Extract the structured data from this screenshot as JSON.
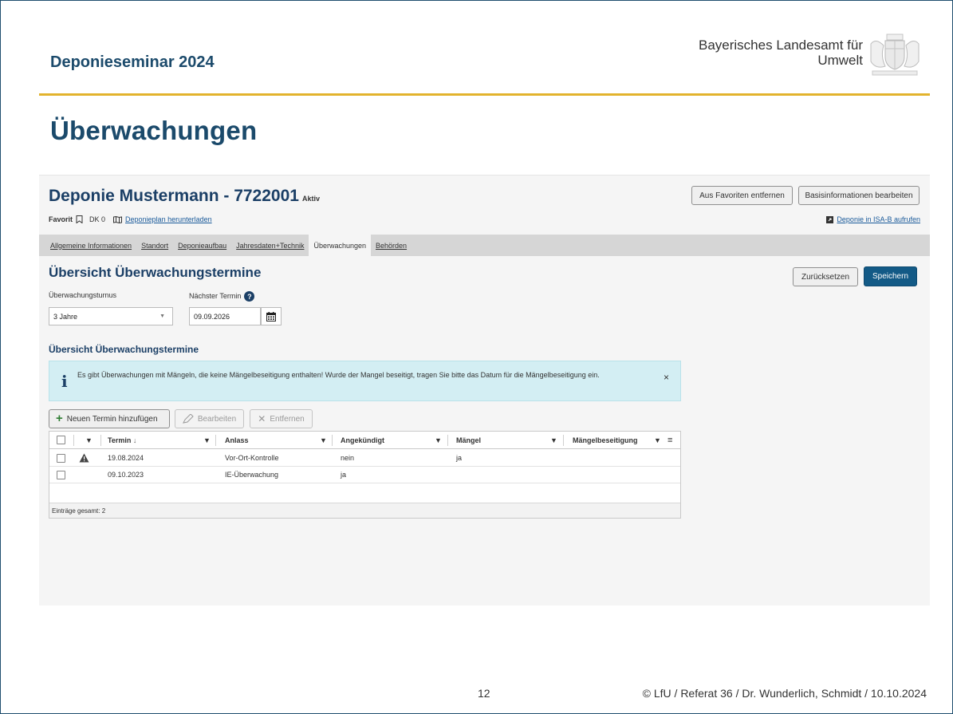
{
  "slide": {
    "seminar_title": "Deponieseminar 2024",
    "org_line1": "Bayerisches Landesamt für",
    "org_line2": "Umwelt",
    "heading": "Überwachungen",
    "page_number": "12",
    "footer": "© LfU / Referat 36 / Dr. Wunderlich, Schmidt / 10.10.2024",
    "accent_color": "#e2b32d",
    "title_color": "#1b4a6b"
  },
  "app": {
    "title": "Deponie Mustermann - 7722001",
    "status": "Aktiv",
    "buttons": {
      "remove_favorite": "Aus Favoriten entfernen",
      "edit_base": "Basisinformationen bearbeiten"
    },
    "meta": {
      "favorite_label": "Favorit",
      "favorite_icon": "bookmark-icon",
      "dk": "DK 0",
      "map_icon": "map-icon",
      "plan_link": "Deponieplan herunterladen",
      "isab_icon": "external-box-icon",
      "isab_link": "Deponie in ISA-B aufrufen"
    },
    "tabs": [
      {
        "label": "Allgemeine Informationen",
        "active": false
      },
      {
        "label": "Standort",
        "active": false
      },
      {
        "label": "Deponieaufbau",
        "active": false
      },
      {
        "label": "Jahresdaten+Technik",
        "active": false
      },
      {
        "label": "Überwachungen",
        "active": true
      },
      {
        "label": "Behörden",
        "active": false
      }
    ],
    "section": {
      "title": "Übersicht Überwachungstermine",
      "reset_label": "Zurücksetzen",
      "save_label": "Speichern",
      "turnus_label": "Überwachungsturnus",
      "turnus_value": "3 Jahre",
      "next_label": "Nächster Termin",
      "next_value": "09.09.2026",
      "sub_title": "Übersicht Überwachungstermine"
    },
    "alert": {
      "icon": "info-icon",
      "text": "Es gibt Überwachungen mit Mängeln, die keine Mängelbeseitigung enthalten! Wurde der Mangel beseitigt, tragen Sie bitte das Datum für die Mängelbeseitigung ein.",
      "close": "×"
    },
    "toolbar": {
      "add_label": "Neuen Termin hinzufügen",
      "edit_label": "Bearbeiten",
      "remove_label": "Entfernen"
    },
    "grid": {
      "columns": [
        "Termin",
        "Anlass",
        "Angekündigt",
        "Mängel",
        "Mängelbeseitigung"
      ],
      "sort_indicator": "↓",
      "rows": [
        {
          "warning": true,
          "termin": "19.08.2024",
          "anlass": "Vor-Ort-Kontrolle",
          "angekuendigt": "nein",
          "maengel": "ja",
          "beseitigung": ""
        },
        {
          "warning": false,
          "termin": "09.10.2023",
          "anlass": "IE-Überwachung",
          "angekuendigt": "ja",
          "maengel": "",
          "beseitigung": ""
        }
      ],
      "footer": "Einträge gesamt: 2"
    }
  }
}
